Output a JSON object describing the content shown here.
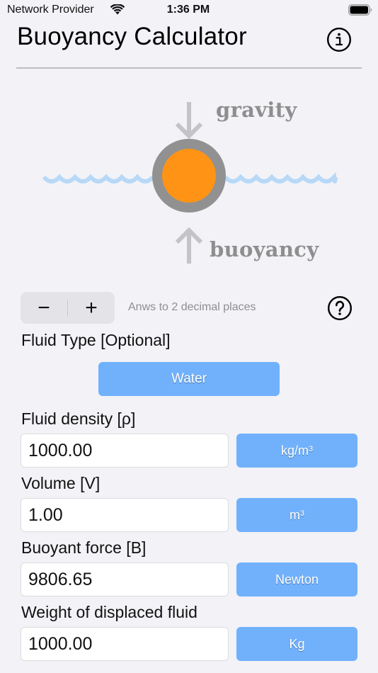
{
  "status_bar": {
    "carrier": "Network Provider",
    "time": "1:36 PM",
    "icons": [
      "wifi-icon",
      "battery-icon"
    ]
  },
  "header": {
    "title": "Buoyancy Calculator",
    "info_icon": "info-circle-icon"
  },
  "diagram": {
    "gravity_label": "gravity",
    "buoyancy_label": "buoyancy",
    "colors": {
      "water": "#B7D8F7",
      "object_ring": "#919191",
      "object_core": "#FF9315",
      "arrow": "#C4C4C6",
      "label": "#8E8E8E"
    }
  },
  "precision": {
    "decrement_label": "−",
    "increment_label": "+",
    "description": "Anws to 2 decimal places",
    "help_icon": "question-circle-icon"
  },
  "fluid_type": {
    "label": "Fluid Type [Optional]",
    "selected": "Water"
  },
  "fields": [
    {
      "label": "Fluid density [ρ]",
      "value": "1000.00",
      "unit": "kg/m³"
    },
    {
      "label": "Volume [V]",
      "value": "1.00",
      "unit": "m³"
    },
    {
      "label": "Buoyant force [B]",
      "value": "9806.65",
      "unit": "Newton"
    },
    {
      "label": "Weight of displaced fluid",
      "value": "1000.00",
      "unit": "Kg"
    }
  ],
  "theme": {
    "accent": "#71B1FC",
    "background": "#F2F2F7"
  }
}
